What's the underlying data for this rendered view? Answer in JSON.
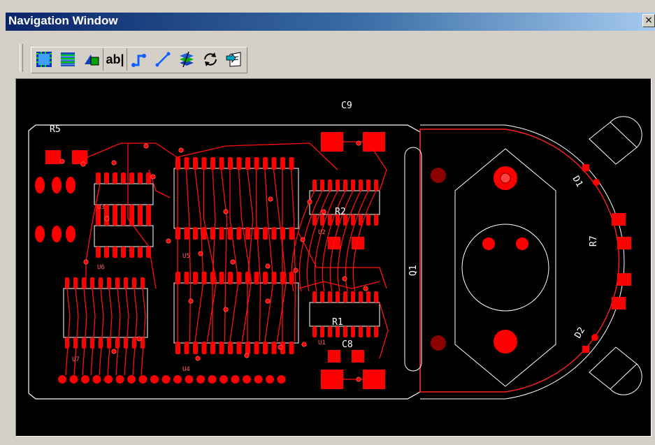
{
  "window": {
    "title": "Navigation Window",
    "close_glyph": "×"
  },
  "toolbar": {
    "buttons": [
      {
        "icon": "board-view-icon"
      },
      {
        "icon": "layers-list-icon"
      },
      {
        "icon": "shape-select-icon"
      },
      {
        "icon": "text-label-icon",
        "text": "ab|"
      },
      {
        "icon": "trace-route-icon"
      },
      {
        "icon": "line-draw-icon"
      },
      {
        "icon": "layer-stack-icon"
      },
      {
        "icon": "refresh-icon"
      },
      {
        "icon": "export-icon"
      }
    ]
  },
  "pcb": {
    "labels": {
      "c9": "C9",
      "r5": "R5",
      "r2": "R2",
      "r1": "R1",
      "c8": "C8",
      "q1": "Q1",
      "r7": "R7",
      "d1": "D1",
      "d2": "D2",
      "u3": "U3",
      "u5": "U5",
      "u6": "U6",
      "u7": "U7",
      "u4": "U4",
      "u1": "U1",
      "u2": "U2"
    },
    "colors": {
      "background": "#000000",
      "outline": "#ffffff",
      "copper": "#ff0000",
      "dark_pad": "#8b0000"
    }
  }
}
